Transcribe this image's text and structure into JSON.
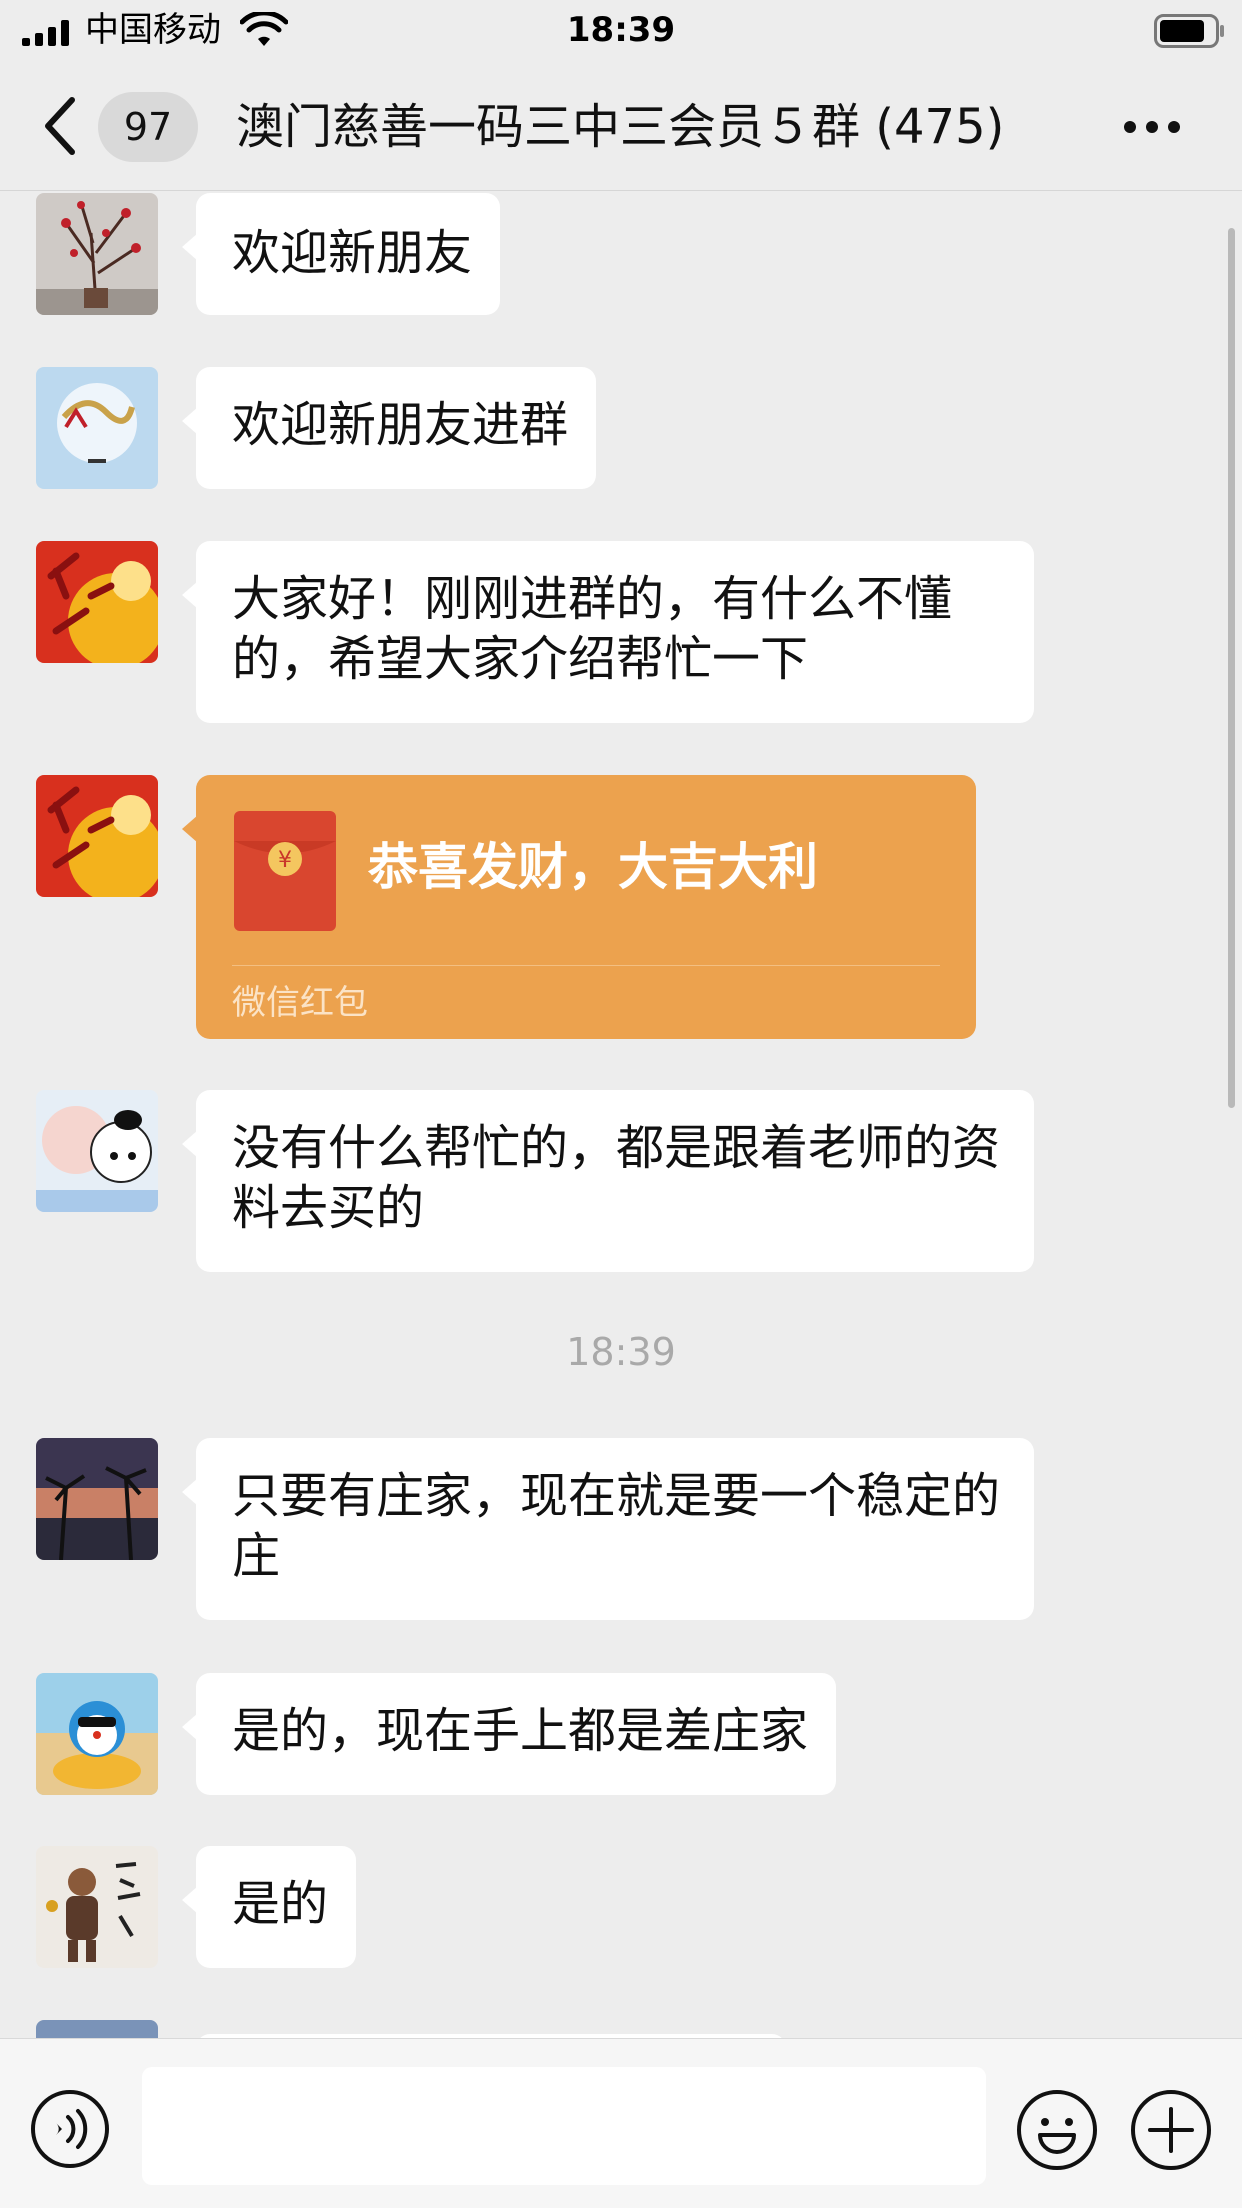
{
  "status_bar": {
    "carrier": "中国移动",
    "time": "18:39"
  },
  "nav": {
    "unread_count": "97",
    "title": "澳门慈善一码三中三会员５群 (475)"
  },
  "messages": [
    {
      "text": "欢迎新朋友",
      "avatar": "plum-blossom-avatar"
    },
    {
      "text": "欢迎新朋友进群",
      "avatar": "dragon-moon-avatar"
    },
    {
      "text": "大家好！刚刚进群的，有什么不懂的，希望大家介绍帮忙一下",
      "avatar": "chengxin-avatar"
    },
    {
      "type": "red_packet",
      "text": "恭喜发财，大吉大利",
      "label": "微信红包",
      "avatar": "chengxin-avatar"
    },
    {
      "text": "没有什么帮忙的，都是跟着老师的资料去买的",
      "avatar": "cartoon-sheep-avatar"
    },
    {
      "text": "只要有庄家，现在就是要一个稳定的庄",
      "avatar": "palm-sunset-avatar"
    },
    {
      "text": "是的，现在手上都是差庄家",
      "avatar": "doraemon-beach-avatar"
    },
    {
      "text": "是的",
      "avatar": "monk-calligraphy-avatar"
    }
  ],
  "timestamp": "18:39",
  "colors": {
    "background": "#ededed",
    "bubble": "#ffffff",
    "red_packet": "#eca24e"
  }
}
